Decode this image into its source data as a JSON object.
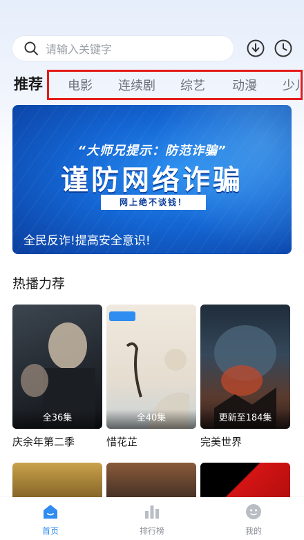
{
  "search": {
    "placeholder": "请输入关键字",
    "icon": "search-icon"
  },
  "header_actions": {
    "download_icon": "download-icon",
    "history_icon": "history-icon"
  },
  "tabs": {
    "active": "推荐",
    "items": [
      "电影",
      "连续剧",
      "综艺",
      "动漫",
      "少儿"
    ]
  },
  "banner": {
    "subtitle": "“大师兄提示：防范诈骗”",
    "title": "谨防网络诈骗",
    "tag": "网上绝不谈钱！",
    "caption": "全民反诈!提高安全意识!"
  },
  "section": {
    "title": "热播力荐"
  },
  "posters": [
    {
      "title": "庆余年第二季",
      "badge": "全36集"
    },
    {
      "title": "惜花芷",
      "badge": "全40集"
    },
    {
      "title": "完美世界",
      "badge": "更新至184集"
    }
  ],
  "nav": {
    "items": [
      {
        "label": "首页",
        "icon": "home-icon"
      },
      {
        "label": "排行榜",
        "icon": "ranking-icon"
      },
      {
        "label": "我的",
        "icon": "profile-icon"
      }
    ]
  },
  "colors": {
    "accent": "#2f8cf0",
    "tab_highlight_border": "#e41b1b",
    "banner_blue": "#1466d4"
  }
}
